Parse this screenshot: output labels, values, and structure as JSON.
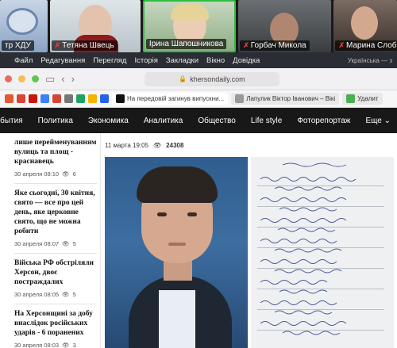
{
  "zoom": {
    "participants": [
      {
        "label": "тр ХДУ",
        "muted": false
      },
      {
        "label": "Тетяна Швець",
        "muted": true
      },
      {
        "label": "Ірина Шапошникова",
        "muted": false
      },
      {
        "label": "Горбач Микола",
        "muted": true
      },
      {
        "label": "Марина Слоб",
        "muted": true
      }
    ]
  },
  "menubar": {
    "items": [
      "Файл",
      "Редагування",
      "Перегляд",
      "Історія",
      "Закладки",
      "Вікно",
      "Довідка"
    ],
    "right": "Українська — з"
  },
  "browser": {
    "url": "khersondaily.com",
    "tabs": [
      {
        "label": "На передовій загинув випускни..."
      },
      {
        "label": "Лапулик Віктор Іванович – Вікі"
      },
      {
        "label": "Удалит"
      }
    ]
  },
  "site_nav": [
    "События",
    "Политика",
    "Экономика",
    "Аналитика",
    "Общество",
    "Life style",
    "Фоторепортаж",
    "Еще"
  ],
  "sidebar_news": [
    {
      "title": "лише перейменуванням вулиць та площ - краснавець",
      "date": "30 апреля 08:10",
      "views": "6"
    },
    {
      "title": "Яке сьогодні, 30 квітня, свято — все про цей день, яке церковне свято, що не можна робити",
      "date": "30 апреля 08:07",
      "views": "5"
    },
    {
      "title": "Війська РФ обстріляли Херсон, двоє постраждалих",
      "date": "30 апреля 08:05",
      "views": "5"
    },
    {
      "title": "На Херсонщині за добу внаслідок російських ударів - 6 поранених",
      "date": "30 апреля 08:03",
      "views": "3"
    }
  ],
  "article": {
    "date": "11 марта 19:05",
    "views": "24308"
  },
  "colors": {
    "speaking_border": "#2fbd3e",
    "mic_muted": "#e23b3b",
    "site_nav_bg": "#181818"
  }
}
